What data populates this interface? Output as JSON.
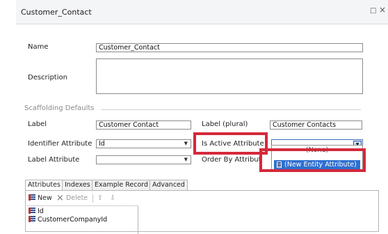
{
  "window": {
    "title": "Customer_Contact",
    "controls": {
      "restore": "□",
      "close": "×"
    }
  },
  "form": {
    "name_label": "Name",
    "name_value": "Customer_Contact",
    "description_label": "Description",
    "description_value": "",
    "scaffolding_title": "Scaffolding Defaults",
    "label_label": "Label",
    "label_value": "Customer Contact",
    "label_plural_label": "Label (plural)",
    "label_plural_value": "Customer Contacts",
    "identifier_label": "Identifier Attribute",
    "identifier_value": "Id",
    "is_active_label": "Is Active Attribute",
    "is_active_value": "",
    "label_attr_label": "Label Attribute",
    "label_attr_value": "",
    "order_by_label": "Order By Attribut",
    "arrow": "▼"
  },
  "dropdown": {
    "options": [
      "(None)",
      "(New Entity Attribute)"
    ],
    "selected_index": 1
  },
  "tabs": [
    {
      "label": "Attributes",
      "selected": true
    },
    {
      "label": "Indexes",
      "selected": false
    },
    {
      "label": "Example Record",
      "selected": false
    },
    {
      "label": "Advanced",
      "selected": false
    }
  ],
  "toolbar": {
    "new_label": "New",
    "delete_icon": "×",
    "delete_label": "Delete",
    "up_icon": "⇧",
    "down_icon": "⇩"
  },
  "attributes": [
    "Id",
    "CustomerCompanyId"
  ],
  "colors": {
    "highlight": "#d4293a",
    "selection": "#2e6fd1",
    "titlebar": "#f4f5f7"
  }
}
